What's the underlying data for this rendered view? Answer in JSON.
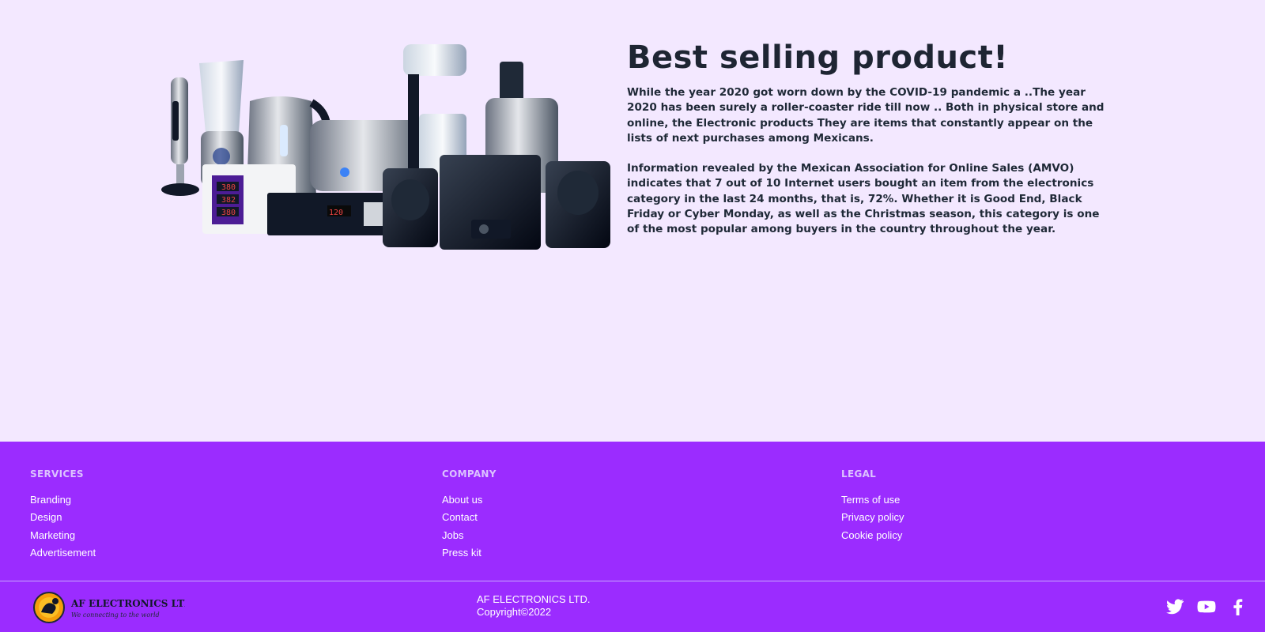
{
  "hero": {
    "title": "Best selling product!",
    "paragraphs": [
      "While the year 2020 got worn down by the COVID-19 pandemic a ..The year 2020 has been surely a roller-coaster ride till now .. Both in physical store and online, the Electronic products They are items that constantly appear on the lists of next purchases among Mexicans.",
      "Information revealed by the Mexican Association for Online Sales (AMVO) indicates that 7 out of 10 Internet users bought an item from the electronics category in the last 24 months, that is, 72%. Whether it is Good End, Black Friday or Cyber Monday, as well as the Christmas season, this category is one of the most popular among buyers in the country throughout the year."
    ],
    "image_alt": "electronics-products-image"
  },
  "footer": {
    "columns": [
      {
        "heading": "SERVICES",
        "links": [
          "Branding",
          "Design",
          "Marketing",
          "Advertisement"
        ]
      },
      {
        "heading": "COMPANY",
        "links": [
          "About us",
          "Contact",
          "Jobs",
          "Press kit"
        ]
      },
      {
        "heading": "LEGAL",
        "links": [
          "Terms of use",
          "Privacy policy",
          "Cookie policy"
        ]
      }
    ],
    "logo": {
      "name": "AF ELECTRONICS LTD",
      "tagline": "We connecting to the world"
    },
    "company_name": "AF ELECTRONICS LTD.",
    "copyright": "Copyright©2022",
    "socials": [
      "twitter-icon",
      "youtube-icon",
      "facebook-icon"
    ]
  },
  "colors": {
    "page_bg": "#f3e8ff",
    "footer_bg": "#9b2cff",
    "heading_muted": "#dcc2ff",
    "title": "#1e2533"
  }
}
